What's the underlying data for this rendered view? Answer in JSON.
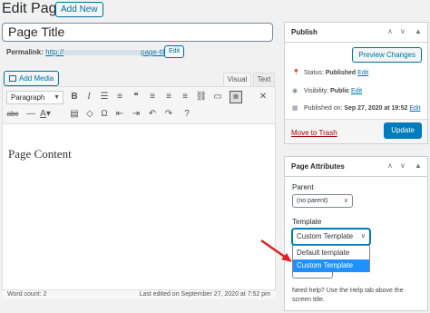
{
  "header": {
    "title": "Edit Page",
    "add_new": "Add New"
  },
  "post": {
    "title": "Page Title",
    "permalink_label": "Permalink:",
    "permalink_prefix": "http://",
    "permalink_slug": "page-title/",
    "edit_label": "Edit"
  },
  "editor": {
    "add_media": "Add Media",
    "tabs": [
      "Visual",
      "Text"
    ],
    "format_select": "Paragraph",
    "content": "Page Content",
    "word_count": "Word count: 2",
    "last_edited": "Last edited on September 27, 2020 at 7:52 pm"
  },
  "publish": {
    "title": "Publish",
    "preview": "Preview Changes",
    "status_label": "Status:",
    "status_value": "Published",
    "status_edit": "Edit",
    "visibility_label": "Visibility:",
    "visibility_value": "Public",
    "visibility_edit": "Edit",
    "published_label": "Published on:",
    "published_value": "Sep 27, 2020 at 19:52",
    "published_edit": "Edit",
    "trash": "Move to Trash",
    "update": "Update"
  },
  "attributes": {
    "title": "Page Attributes",
    "parent_label": "Parent",
    "parent_value": "(no parent)",
    "template_label": "Template",
    "template_value": "Custom Template",
    "template_options": [
      "Default template",
      "Custom Template"
    ],
    "help": "Need help? Use the Help tab above the screen title."
  },
  "icons": {
    "panel_controls": [
      "chevron-up-icon",
      "chevron-down-icon",
      "caret-up-icon"
    ],
    "toolbar_row1": [
      "bold-icon",
      "italic-icon",
      "bullet-list-icon",
      "numbered-list-icon",
      "blockquote-icon",
      "align-left-icon",
      "align-center-icon",
      "align-right-icon",
      "link-icon",
      "more-tag-icon",
      "toolbar-toggle-icon",
      "fullscreen-icon"
    ],
    "toolbar_row2": [
      "strikethrough-icon",
      "horizontal-rule-icon",
      "text-color-icon",
      "paste-text-icon",
      "clear-formatting-icon",
      "special-character-icon",
      "outdent-icon",
      "indent-icon",
      "undo-icon",
      "redo-icon",
      "help-icon"
    ]
  },
  "colors": {
    "accent": "#0071a1",
    "primary": "#007cba",
    "danger": "#a00",
    "selected": "#1e90ff",
    "arrow": "#e02020"
  }
}
